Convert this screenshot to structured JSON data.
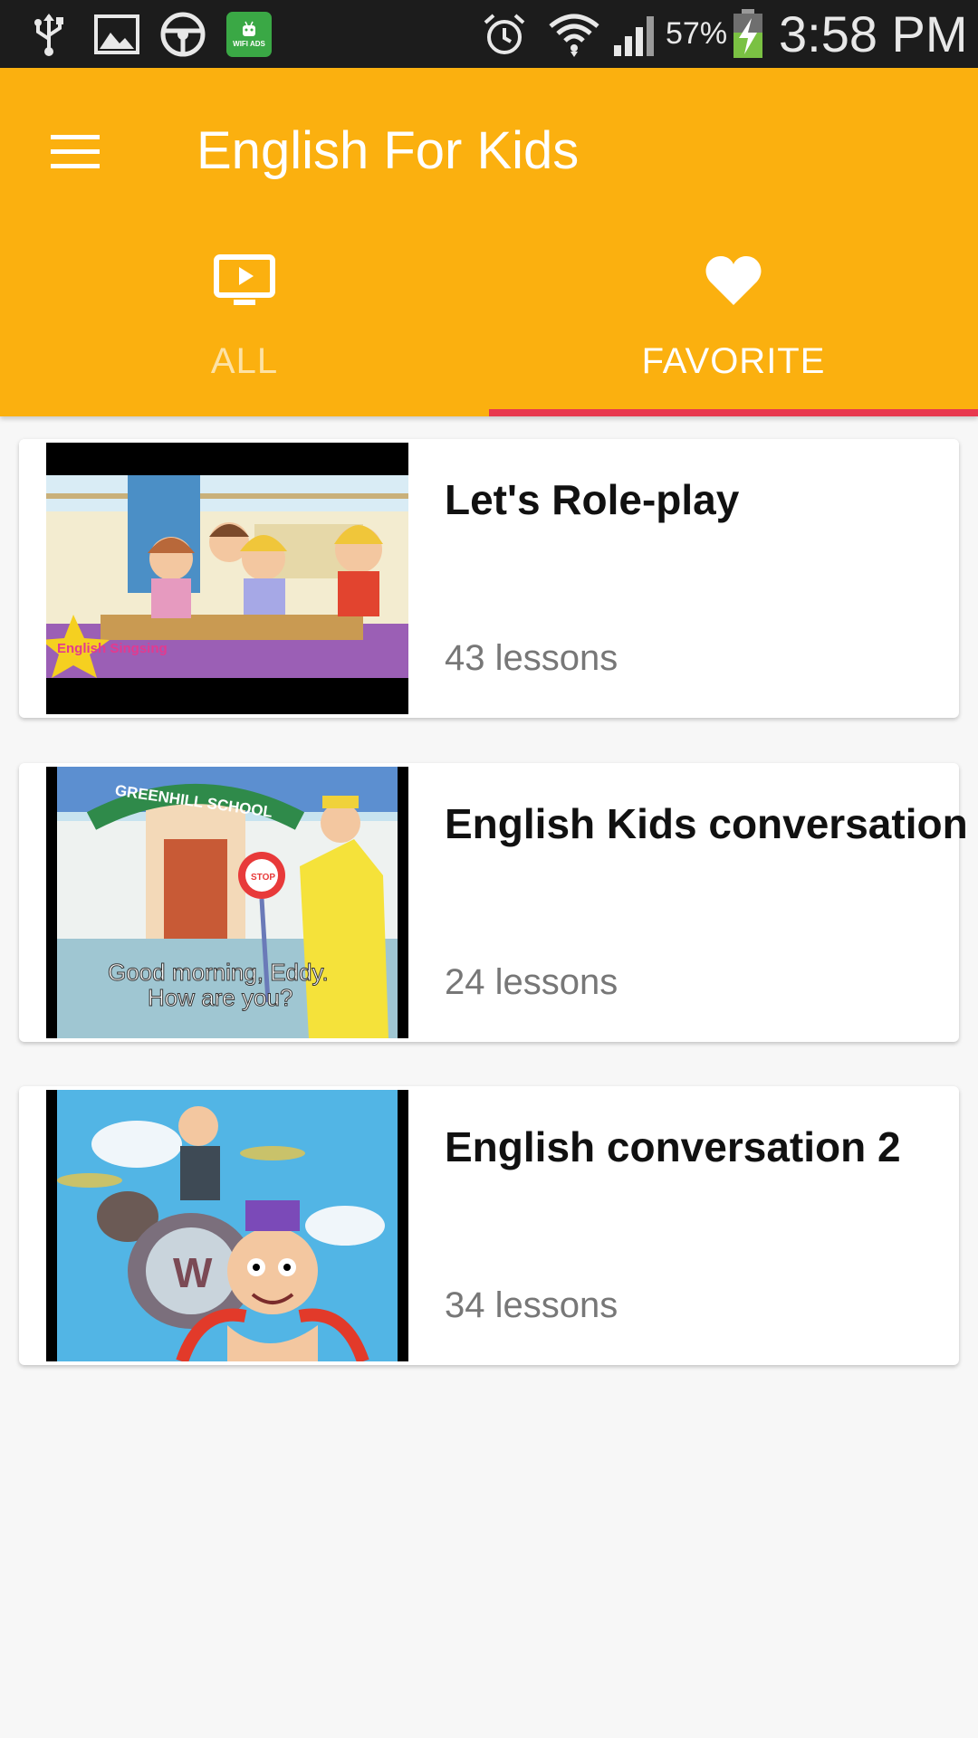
{
  "status_bar": {
    "battery_percent": "57%",
    "time": "3:58 PM",
    "wifi_ads_label": "WIFI ADS",
    "icons": [
      "usb-icon",
      "image-icon",
      "steering-wheel-icon",
      "wifi-ads-icon",
      "alarm-icon",
      "wifi-icon",
      "signal-icon",
      "battery-charging-icon"
    ]
  },
  "app_bar": {
    "title": "English For Kids",
    "color": "#fbb00f",
    "menu_icon": "hamburger-menu-icon"
  },
  "tabs": [
    {
      "label": "ALL",
      "icon": "tv-play-icon",
      "selected": false
    },
    {
      "label": "FAVORITE",
      "icon": "heart-icon",
      "selected": true
    }
  ],
  "indicator_color": "#e8384f",
  "playlists": [
    {
      "title": "Let's Role-play",
      "lessons": "43 lessons",
      "thumbnail_badge": "English Singsing"
    },
    {
      "title": "English Kids conversation",
      "lessons": "24 lessons",
      "thumbnail_sign": "GREENHILL SCHOOL",
      "thumbnail_caption_1": "Good morning, Eddy.",
      "thumbnail_caption_2": "How are you?",
      "thumbnail_stop": "STOP"
    },
    {
      "title": "English conversation 2",
      "lessons": "34 lessons",
      "thumbnail_drum_letter": "W"
    }
  ]
}
